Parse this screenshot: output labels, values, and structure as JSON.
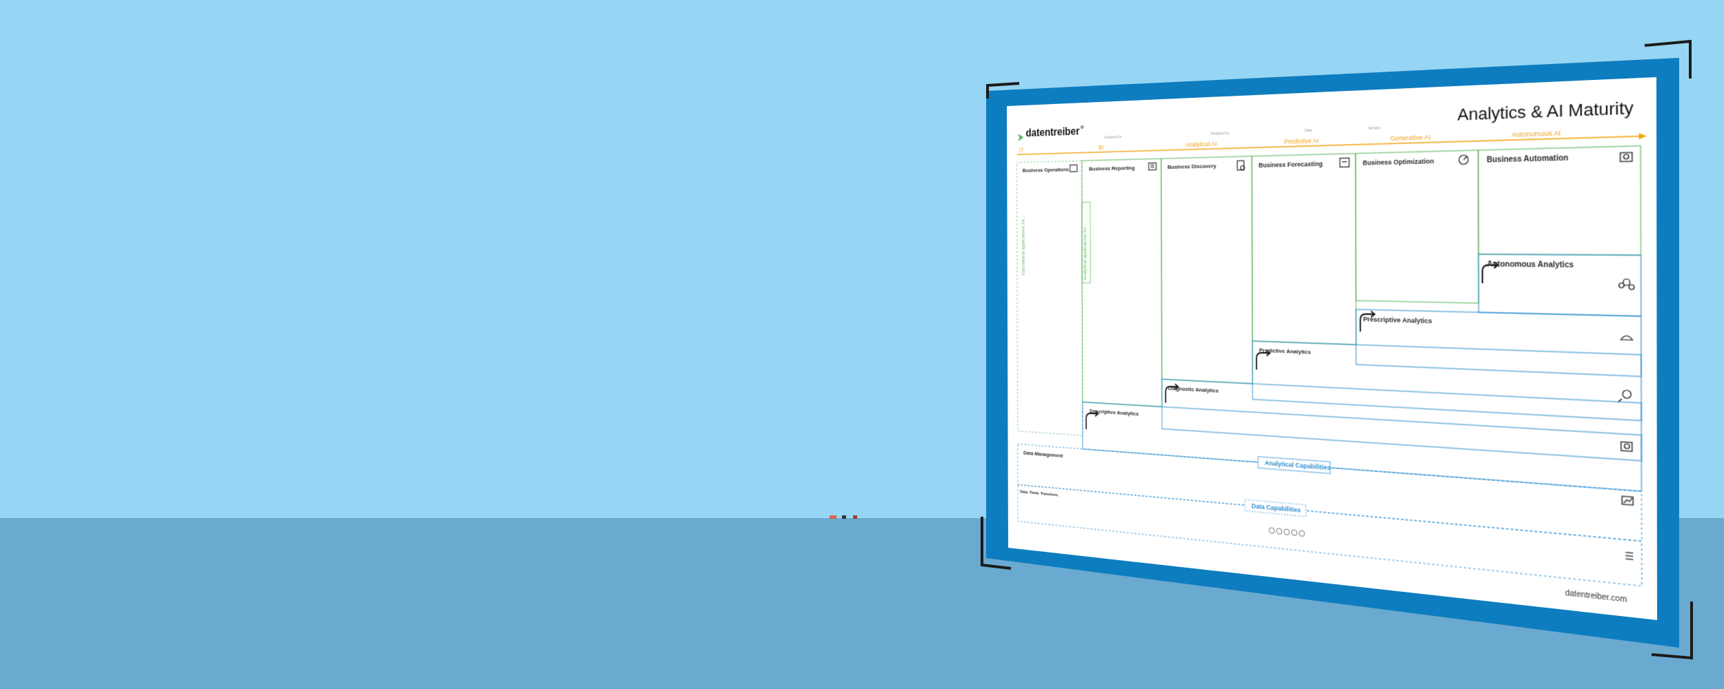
{
  "poster": {
    "brand": "datentreiber",
    "brand_mark": "®",
    "title": "Analytics & AI Maturity",
    "footer_url": "datentreiber.com",
    "footer_left": "Data. Think. Transform.",
    "header_fields": [
      "Designed for",
      "Designed by",
      "Date",
      "Version"
    ],
    "stages": [
      "IT",
      "BI",
      "Analytical AI",
      "Predictive AI",
      "Generative AI",
      "Autonomous AI"
    ],
    "business_cells": [
      "Business Operations",
      "Business Reporting",
      "Business Discovery",
      "Business Forecasting",
      "Business Optimization",
      "Business Automation"
    ],
    "analytics_cells": [
      "Descriptive Analytics",
      "Diagnostic Analytics",
      "Predictive Analytics",
      "Prescriptive Analytics",
      "Autonomous Analytics"
    ],
    "data_management": "Data Management",
    "analytical_capabilities": "Analytical Capabilities",
    "data_capabilities": "Data Capabilities",
    "side_labels": [
      "Operational applications for...",
      "Analytical applications for..."
    ]
  },
  "colors": {
    "background": "#96d5f3",
    "floor": "#6aaad0",
    "frame": "#0e7dbf",
    "stage_orange": "#f2a418",
    "green": "#5cb35a",
    "blue": "#2f8fd0"
  }
}
